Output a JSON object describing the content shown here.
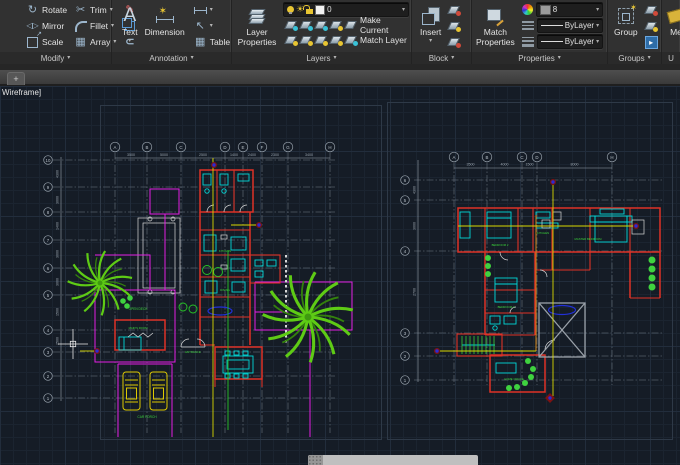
{
  "ribbon": {
    "modify": {
      "label": "Modify",
      "rotate": "Rotate",
      "trim": "Trim",
      "mirror": "Mirror",
      "fillet": "Fillet",
      "scale": "Scale",
      "array": "Array"
    },
    "annotation": {
      "label": "Annotation",
      "text": "Text",
      "dimension": "Dimension",
      "table": "Table"
    },
    "layers": {
      "label": "Layers",
      "layer_properties_1": "Layer",
      "layer_properties_2": "Properties",
      "current_layer": "0",
      "make_current": "Make Current",
      "match_layer": "Match Layer"
    },
    "block": {
      "label": "Block",
      "insert": "Insert"
    },
    "properties": {
      "label": "Properties",
      "match_properties_1": "Match",
      "match_properties_2": "Properties",
      "color_value": "8",
      "linetype": "ByLayer",
      "lineweight": "ByLayer"
    },
    "groups": {
      "label": "Groups",
      "group": "Group"
    },
    "utilities": {
      "label": "U",
      "measure": "Me"
    }
  },
  "tabbar": {
    "new_tab": "+"
  },
  "viewport": {
    "label": "Wireframe]"
  },
  "plans": {
    "left": {
      "grid_cols": [
        "A",
        "B",
        "C",
        "D",
        "E",
        "F",
        "G",
        "H"
      ],
      "col_dims": [
        "3500",
        "5000",
        "2500",
        "1400",
        "2400",
        "2300",
        "3400"
      ],
      "grid_rows": [
        "10",
        "9",
        "8",
        "7",
        "6",
        "5",
        "4",
        "3",
        "2",
        "1"
      ],
      "row_dims": [
        "4300",
        "3000",
        "1400",
        "3000",
        "3000",
        "1500",
        "2500"
      ],
      "labels": {
        "open_deck": "OPEN DECK",
        "maids_room": "MAID'S ROOM",
        "entrance": "ENTRANCE",
        "car_porch": "CAR PORCH",
        "kitchen": "KITCHEN",
        "dining": "DINING"
      }
    },
    "right": {
      "grid_cols": [
        "A",
        "B",
        "C",
        "D",
        "H"
      ],
      "col_dims": [
        "3500",
        "4000",
        "1500",
        "8000"
      ],
      "grid_rows": [
        "6",
        "5",
        "4",
        "3",
        "2",
        "1"
      ],
      "row_dims": [
        "4300",
        "3000",
        "2700"
      ],
      "labels": {
        "bedroom2": "BEDROOM 2",
        "master_bedroom": "MASTER BEDROOM",
        "bedroom3": "BEDROOM 3",
        "home_office": "HOME OFFICE",
        "kitchen": "KITCHEN"
      }
    }
  }
}
